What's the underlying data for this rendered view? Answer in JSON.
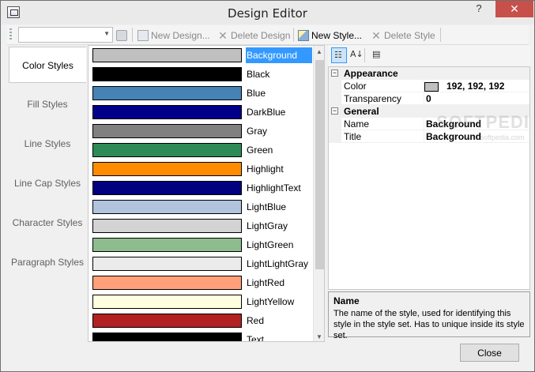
{
  "window": {
    "title": "Design Editor",
    "help_glyph": "?",
    "close_glyph": "✕"
  },
  "toolbar": {
    "combo_value": "",
    "new_design": "New Design...",
    "delete_design": "Delete Design",
    "new_style": "New Style...",
    "delete_style": "Delete Style"
  },
  "tabs": [
    "Color Styles",
    "Fill Styles",
    "Line Styles",
    "Line Cap Styles",
    "Character Styles",
    "Paragraph Styles"
  ],
  "active_tab": "Color Styles",
  "styles": [
    {
      "name": "Background",
      "color": "#c0c0c0",
      "selected": true
    },
    {
      "name": "Black",
      "color": "#000000"
    },
    {
      "name": "Blue",
      "color": "#4682b4"
    },
    {
      "name": "DarkBlue",
      "color": "#00008b"
    },
    {
      "name": "Gray",
      "color": "#808080"
    },
    {
      "name": "Green",
      "color": "#2e8b57"
    },
    {
      "name": "Highlight",
      "color": "#ff8c00"
    },
    {
      "name": "HighlightText",
      "color": "#000080"
    },
    {
      "name": "LightBlue",
      "color": "#b0c4de"
    },
    {
      "name": "LightGray",
      "color": "#d3d3d3"
    },
    {
      "name": "LightGreen",
      "color": "#8fbc8f"
    },
    {
      "name": "LightLightGray",
      "color": "#ebebeb"
    },
    {
      "name": "LightRed",
      "color": "#ffa07a"
    },
    {
      "name": "LightYellow",
      "color": "#ffffe0"
    },
    {
      "name": "Red",
      "color": "#b22222"
    },
    {
      "name": "Text",
      "color": "#000000"
    }
  ],
  "properties": {
    "categories": [
      {
        "name": "Appearance",
        "toggle": "−",
        "items": [
          {
            "name": "Color",
            "value": "192, 192, 192",
            "chip": "#c0c0c0"
          },
          {
            "name": "Transparency",
            "value": "0"
          }
        ]
      },
      {
        "name": "General",
        "toggle": "−",
        "items": [
          {
            "name": "Name",
            "value": "Background"
          },
          {
            "name": "Title",
            "value": "Background"
          }
        ]
      }
    ]
  },
  "help": {
    "title": "Name",
    "text": "The name of the style, used for identifying this style in the style set. Has to unique inside its style set."
  },
  "buttons": {
    "close": "Close"
  },
  "watermark": {
    "main": "SOFTPEDIA",
    "sub": "www.softpedia.com"
  }
}
